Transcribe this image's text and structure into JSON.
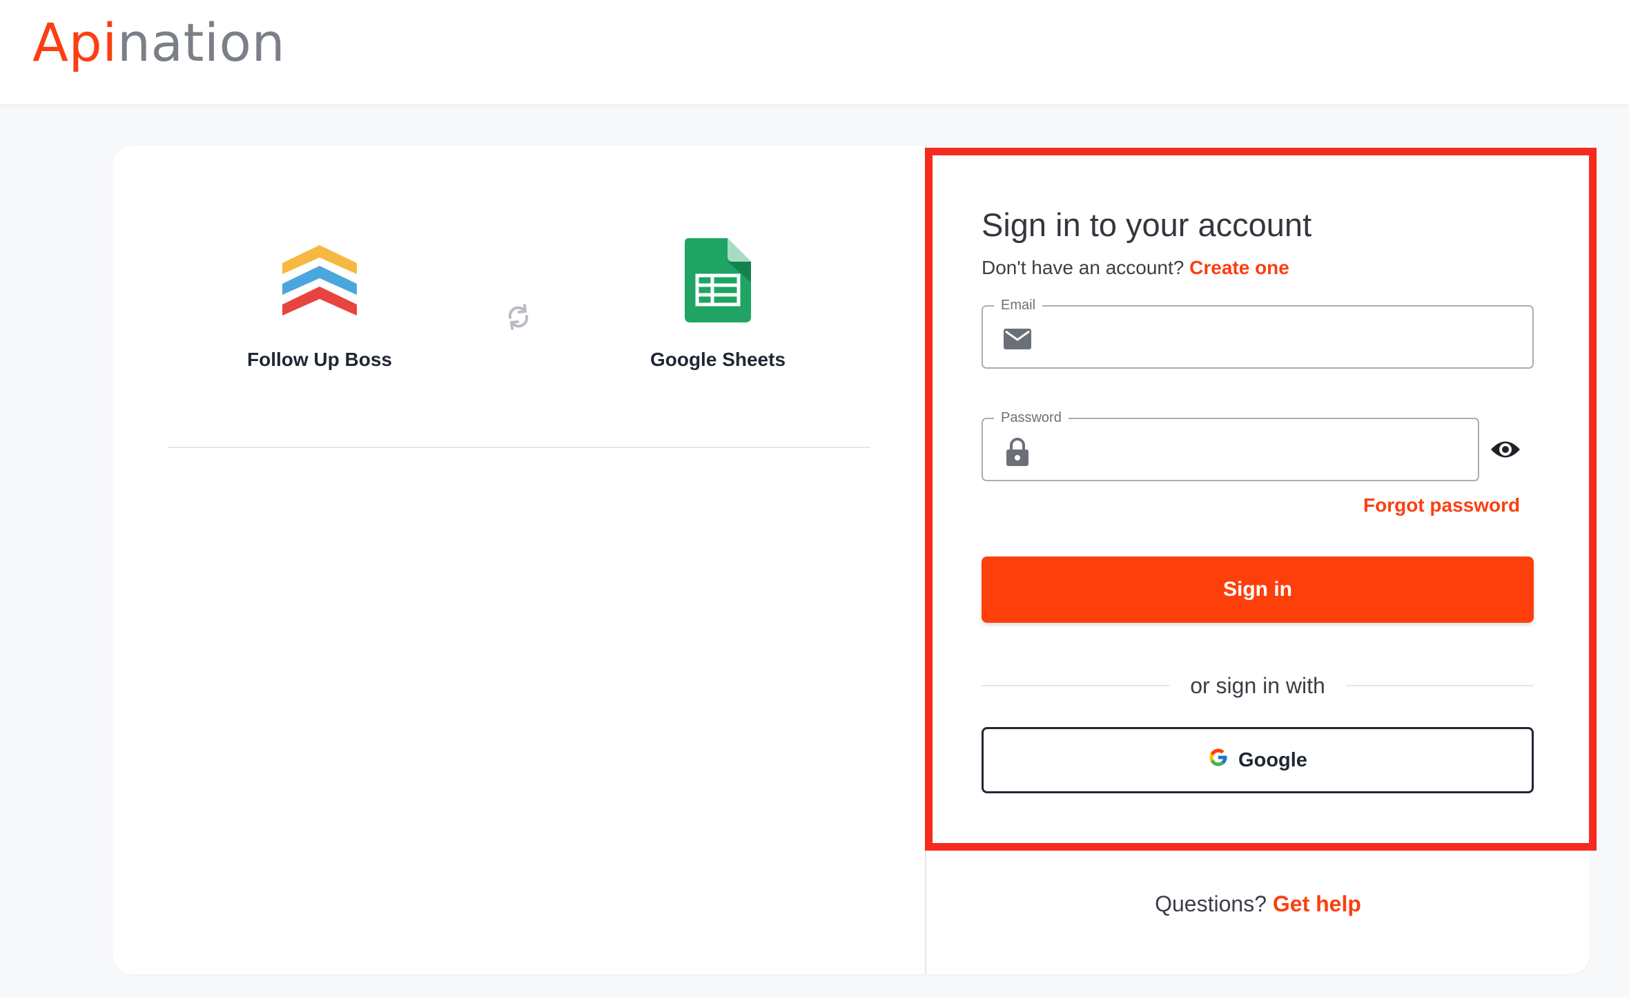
{
  "header": {
    "logo_part1": "Api",
    "logo_part2": "nation"
  },
  "integration": {
    "source_app": {
      "name": "Follow Up Boss",
      "icon": "follow-up-boss-logo"
    },
    "target_app": {
      "name": "Google Sheets",
      "icon": "google-sheets-logo"
    },
    "sync_icon": "sync-icon"
  },
  "signin": {
    "title": "Sign in to your account",
    "no_account_text": "Don't have an account?",
    "create_link": "Create one",
    "email_label": "Email",
    "email_value": "",
    "password_label": "Password",
    "password_value": "",
    "forgot_link": "Forgot password",
    "submit_label": "Sign in",
    "or_text": "or sign in with",
    "google_label": "Google"
  },
  "footer": {
    "questions_text": "Questions?",
    "help_link": "Get help"
  },
  "colors": {
    "brand": "#fb3f12",
    "button": "#fd3f0c",
    "highlight_border": "#f42b1e"
  }
}
